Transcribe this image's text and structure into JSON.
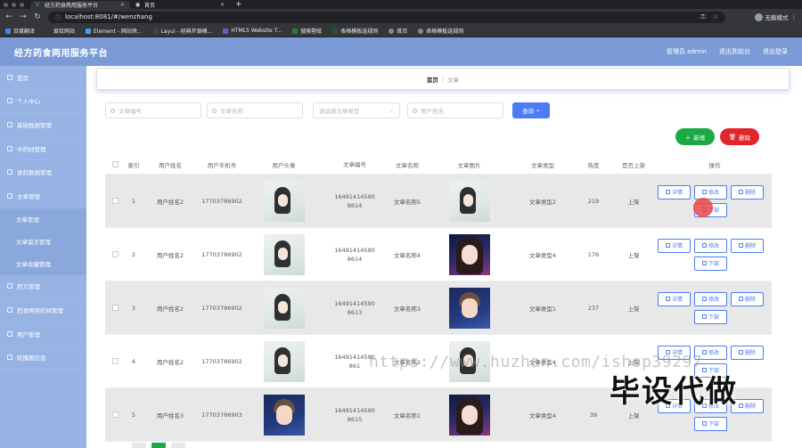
{
  "browser": {
    "tabs": [
      {
        "title": "经方药食两用服务平台",
        "active": true
      },
      {
        "title": "首页",
        "active": false
      }
    ],
    "url": "localhost:8081/#/wenzhang",
    "profile_label": "无痕模式",
    "bookmarks": [
      "百度翻译",
      "爱给网站",
      "Element - 网站快...",
      "Layui - 经典开源模...",
      "HTML5 Website T...",
      "搜索壁纸",
      "表格模板选规则",
      "首页",
      "表格模板选规则"
    ]
  },
  "header": {
    "title": "经方药食两用服务平台",
    "admin_label": "管理员 admin",
    "front_label": "退出到前台",
    "logout_label": "退出登录"
  },
  "sidebar": {
    "items": [
      {
        "label": "首页"
      },
      {
        "label": "个人中心"
      },
      {
        "label": "基础数据管理"
      },
      {
        "label": "中药材管理"
      },
      {
        "label": "食药数据管理"
      },
      {
        "label": "文章管理"
      }
    ],
    "submenu": [
      "文章管理",
      "文章留言管理",
      "文章收藏管理"
    ],
    "items_after": [
      {
        "label": "药方管理"
      },
      {
        "label": "药食两用药材管理"
      },
      {
        "label": "用户管理"
      },
      {
        "label": "轮播图信息"
      }
    ]
  },
  "breadcrumb": {
    "home": "首页",
    "separator": "/",
    "current": "文章"
  },
  "search": {
    "placeholders": [
      "文章编号",
      "文章名称"
    ],
    "select_placeholder": "请选择文章类型",
    "user_placeholder": "用户姓名",
    "query_label": "查询"
  },
  "actions": {
    "add_label": "新增",
    "delete_label": "删除"
  },
  "table": {
    "headers": [
      "索引",
      "用户姓名",
      "用户手机号",
      "用户头像",
      "文章编号",
      "文章名称",
      "文章图片",
      "文章类型",
      "热度",
      "是否上架",
      "操作"
    ],
    "op_labels": {
      "detail": "详情",
      "edit": "修改",
      "delete": "删除",
      "offshelf": "下架"
    },
    "rows": [
      {
        "index": "1",
        "user_name": "用户姓名2",
        "phone": "17703786902",
        "avatar": "girl-a",
        "no_line1": "16491414590",
        "no_line2": "8614",
        "name": "文章名称5",
        "image": "girl-a",
        "type": "文章类型2",
        "heat": "219",
        "shelf": "上架"
      },
      {
        "index": "2",
        "user_name": "用户姓名2",
        "phone": "17703786902",
        "avatar": "girl-a",
        "no_line1": "16491414590",
        "no_line2": "8614",
        "name": "文章名称4",
        "image": "girl-b",
        "type": "文章类型4",
        "heat": "176",
        "shelf": "上架"
      },
      {
        "index": "3",
        "user_name": "用户姓名2",
        "phone": "17703786902",
        "avatar": "girl-a",
        "no_line1": "16491414590",
        "no_line2": "8613",
        "name": "文章名称3",
        "image": "boy",
        "type": "文章类型1",
        "heat": "237",
        "shelf": "上架"
      },
      {
        "index": "4",
        "user_name": "用户姓名2",
        "phone": "17703786902",
        "avatar": "girl-a",
        "no_line1": "16491414590",
        "no_line2": "861",
        "name": "文章名称2",
        "image": "girl-a",
        "type": "文章类型4",
        "heat": "",
        "shelf": "上架"
      },
      {
        "index": "5",
        "user_name": "用户姓名3",
        "phone": "17703786903",
        "avatar": "boy",
        "no_line1": "16491414590",
        "no_line2": "8615",
        "name": "文章名称1",
        "image": "girl-b",
        "type": "文章类型4",
        "heat": "39",
        "shelf": "上架"
      }
    ]
  },
  "watermark": {
    "url_text": "https://www.huzhan.com/ishop39297",
    "cn_text": "毕设代做"
  }
}
